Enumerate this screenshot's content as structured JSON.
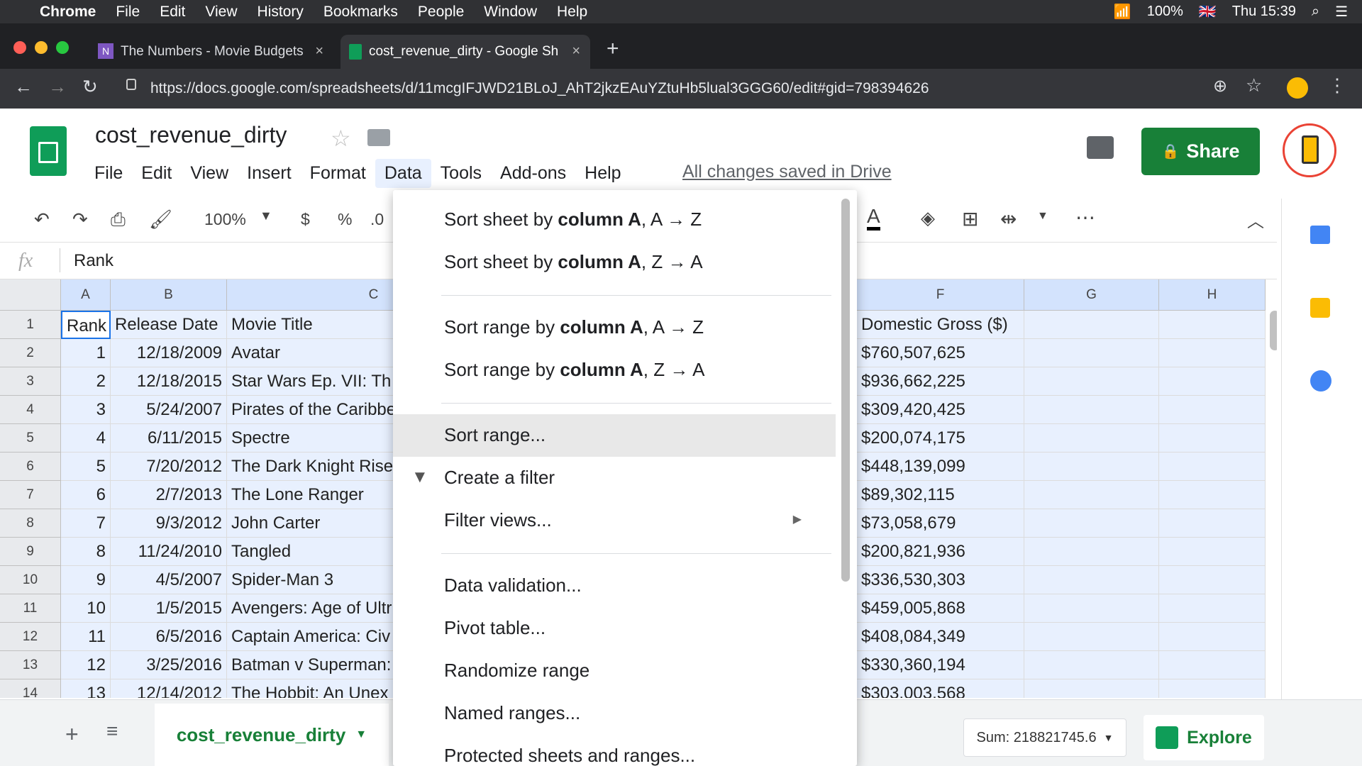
{
  "macbar": {
    "apple": "",
    "app": "Chrome",
    "menus": [
      "File",
      "Edit",
      "View",
      "History",
      "Bookmarks",
      "People",
      "Window",
      "Help"
    ],
    "battery": "100%",
    "clock": "Thu 15:39"
  },
  "tabs": [
    {
      "label": "The Numbers - Movie Budgets",
      "close": "×"
    },
    {
      "label": "cost_revenue_dirty - Google Sh",
      "close": "×"
    }
  ],
  "new_tab": "+",
  "url": "https://docs.google.com/spreadsheets/d/11mcgIFJWD21BLoJ_AhT2jkzEAuYZtuHb5lual3GGG60/edit#gid=798394626",
  "doc": {
    "title": "cost_revenue_dirty",
    "menus": [
      "File",
      "Edit",
      "View",
      "Insert",
      "Format",
      "Data",
      "Tools",
      "Add-ons",
      "Help"
    ],
    "saved": "All changes saved in Drive",
    "share": "Share"
  },
  "fmt": {
    "zoom": "100%",
    "currency": "$",
    "percent": "%",
    "decimal": ".0"
  },
  "formula": {
    "fx": "fx",
    "value": "Rank"
  },
  "grid": {
    "columns": [
      "A",
      "B",
      "C",
      "F",
      "G",
      "H"
    ],
    "rows": [
      {
        "n": "1",
        "a": "Rank",
        "b": "Release Date",
        "c": "Movie Title",
        "f": "Domestic Gross ($)"
      },
      {
        "n": "2",
        "a": "1",
        "b": "12/18/2009",
        "c": "Avatar",
        "f": "$760,507,625"
      },
      {
        "n": "3",
        "a": "2",
        "b": "12/18/2015",
        "c": "Star Wars Ep. VII: Th",
        "f": "$936,662,225"
      },
      {
        "n": "4",
        "a": "3",
        "b": "5/24/2007",
        "c": "Pirates of the Caribbe",
        "f": "$309,420,425"
      },
      {
        "n": "5",
        "a": "4",
        "b": "6/11/2015",
        "c": "Spectre",
        "f": "$200,074,175"
      },
      {
        "n": "6",
        "a": "5",
        "b": "7/20/2012",
        "c": "The Dark Knight Rise",
        "f": "$448,139,099"
      },
      {
        "n": "7",
        "a": "6",
        "b": "2/7/2013",
        "c": "The Lone Ranger",
        "f": "$89,302,115"
      },
      {
        "n": "8",
        "a": "7",
        "b": "9/3/2012",
        "c": "John Carter",
        "f": "$73,058,679"
      },
      {
        "n": "9",
        "a": "8",
        "b": "11/24/2010",
        "c": "Tangled",
        "f": "$200,821,936"
      },
      {
        "n": "10",
        "a": "9",
        "b": "4/5/2007",
        "c": "Spider-Man 3",
        "f": "$336,530,303"
      },
      {
        "n": "11",
        "a": "10",
        "b": "1/5/2015",
        "c": "Avengers: Age of Ultr",
        "f": "$459,005,868"
      },
      {
        "n": "12",
        "a": "11",
        "b": "6/5/2016",
        "c": "Captain America: Civ",
        "f": "$408,084,349"
      },
      {
        "n": "13",
        "a": "12",
        "b": "3/25/2016",
        "c": "Batman v Superman:",
        "f": "$330,360,194"
      },
      {
        "n": "14",
        "a": "13",
        "b": "12/14/2012",
        "c": "The Hobbit: An Unex",
        "f": "$303,003,568"
      }
    ]
  },
  "menu_data": {
    "sort_sheet_az": {
      "pre": "Sort sheet by ",
      "bold": "column A",
      ",post": "",
      "post": ", A → Z"
    },
    "sort_sheet_za": {
      "pre": "Sort sheet by ",
      "bold": "column A",
      "post": ", Z → A"
    },
    "sort_range_az": {
      "pre": "Sort range by ",
      "bold": "column A",
      "post": ", A → Z"
    },
    "sort_range_za": {
      "pre": "Sort range by ",
      "bold": "column A",
      "post": ", Z → A"
    },
    "sort_range": "Sort range...",
    "create_filter": "Create a filter",
    "filter_views": "Filter views...",
    "data_validation": "Data validation...",
    "pivot_table": "Pivot table...",
    "randomize": "Randomize range",
    "named_ranges": "Named ranges...",
    "protected": "Protected sheets and ranges..."
  },
  "bottom": {
    "add": "+",
    "sheet_name": "cost_revenue_dirty",
    "sum": "Sum: 218821745.6",
    "explore": "Explore"
  },
  "colors": {
    "green": "#188038",
    "sheet_green": "#0f9d58",
    "selection": "#e8f0fe"
  }
}
